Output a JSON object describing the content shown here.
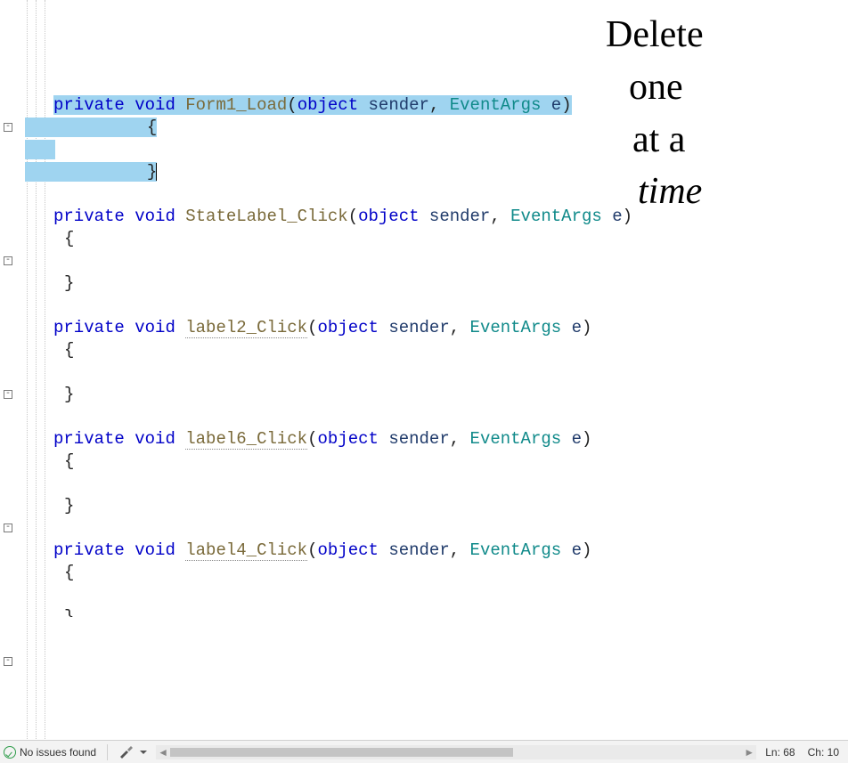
{
  "methods": [
    {
      "name": "Form1_Load",
      "param1_type": "object",
      "param1_name": "sender",
      "param2_type": "EventArgs",
      "param2_name": "e",
      "selected": true
    },
    {
      "name": "StateLabel_Click",
      "param1_type": "object",
      "param1_name": "sender",
      "param2_type": "EventArgs",
      "param2_name": "e",
      "selected": false
    },
    {
      "name": "label2_Click",
      "param1_type": "object",
      "param1_name": "sender",
      "param2_type": "EventArgs",
      "param2_name": "e",
      "selected": false
    },
    {
      "name": "label6_Click",
      "param1_type": "object",
      "param1_name": "sender",
      "param2_type": "EventArgs",
      "param2_name": "e",
      "selected": false
    },
    {
      "name": "label4_Click",
      "param1_type": "object",
      "param1_name": "sender",
      "param2_type": "EventArgs",
      "param2_name": "e",
      "selected": false
    }
  ],
  "keywords": {
    "private": "private",
    "void": "void",
    "object": "object"
  },
  "symbols": {
    "open_brace": "{",
    "close_brace": "}",
    "open_paren": "(",
    "close_paren": ")",
    "comma_sp": ", ",
    "space": " "
  },
  "fold_glyph": "-",
  "annotation": {
    "line1": "Delete",
    "line2": "one",
    "line3": "at a",
    "line4": "time"
  },
  "statusbar": {
    "issues": "No issues found",
    "line_label": "Ln:",
    "line_value": "68",
    "col_label": "Ch:",
    "col_value": "10"
  },
  "icons": {
    "check": "check-circle",
    "brush": "brush",
    "dropdown": "chevron-down",
    "scroll_left": "◄",
    "scroll_right": "►"
  }
}
